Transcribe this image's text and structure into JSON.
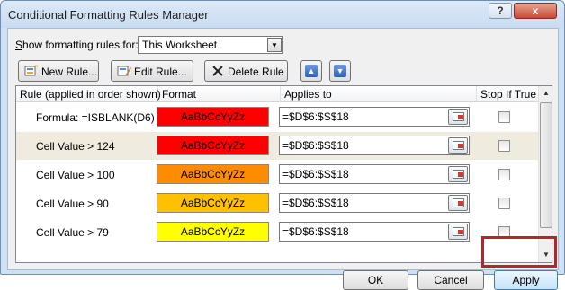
{
  "window": {
    "title": "Conditional Formatting Rules Manager",
    "help_label": "?",
    "close_label": "x"
  },
  "scope": {
    "label_prefix": "S",
    "label_rest": "how formatting rules for:",
    "selected": "This Worksheet"
  },
  "toolbar": {
    "new_label": "New Rule...",
    "edit_label": "Edit Rule...",
    "delete_label": "Delete Rule"
  },
  "columns": {
    "rule": "Rule (applied in order shown)",
    "format": "Format",
    "applies": "Applies to",
    "stop": "Stop If True"
  },
  "rules": [
    {
      "rule": "Formula: =ISBLANK(D6)",
      "preview": "AaBbCcYyZz",
      "color": "#ff0000",
      "applies": "=$D$6:$S$18",
      "stop": false
    },
    {
      "rule": "Cell Value > 124",
      "preview": "AaBbCcYyZz",
      "color": "#ff0000",
      "applies": "=$D$6:$S$18",
      "stop": false
    },
    {
      "rule": "Cell Value > 100",
      "preview": "AaBbCcYyZz",
      "color": "#ff8c00",
      "applies": "=$D$6:$S$18",
      "stop": false
    },
    {
      "rule": "Cell Value > 90",
      "preview": "AaBbCcYyZz",
      "color": "#ffc000",
      "applies": "=$D$6:$S$18",
      "stop": false
    },
    {
      "rule": "Cell Value > 79",
      "preview": "AaBbCcYyZz",
      "color": "#ffff00",
      "applies": "=$D$6:$S$18",
      "stop": false
    }
  ],
  "footer": {
    "ok_label": "OK",
    "cancel_label": "Cancel",
    "apply_label": "Apply"
  },
  "colors": {
    "highlight": "#b3262a",
    "selected_row": "#efebde"
  }
}
